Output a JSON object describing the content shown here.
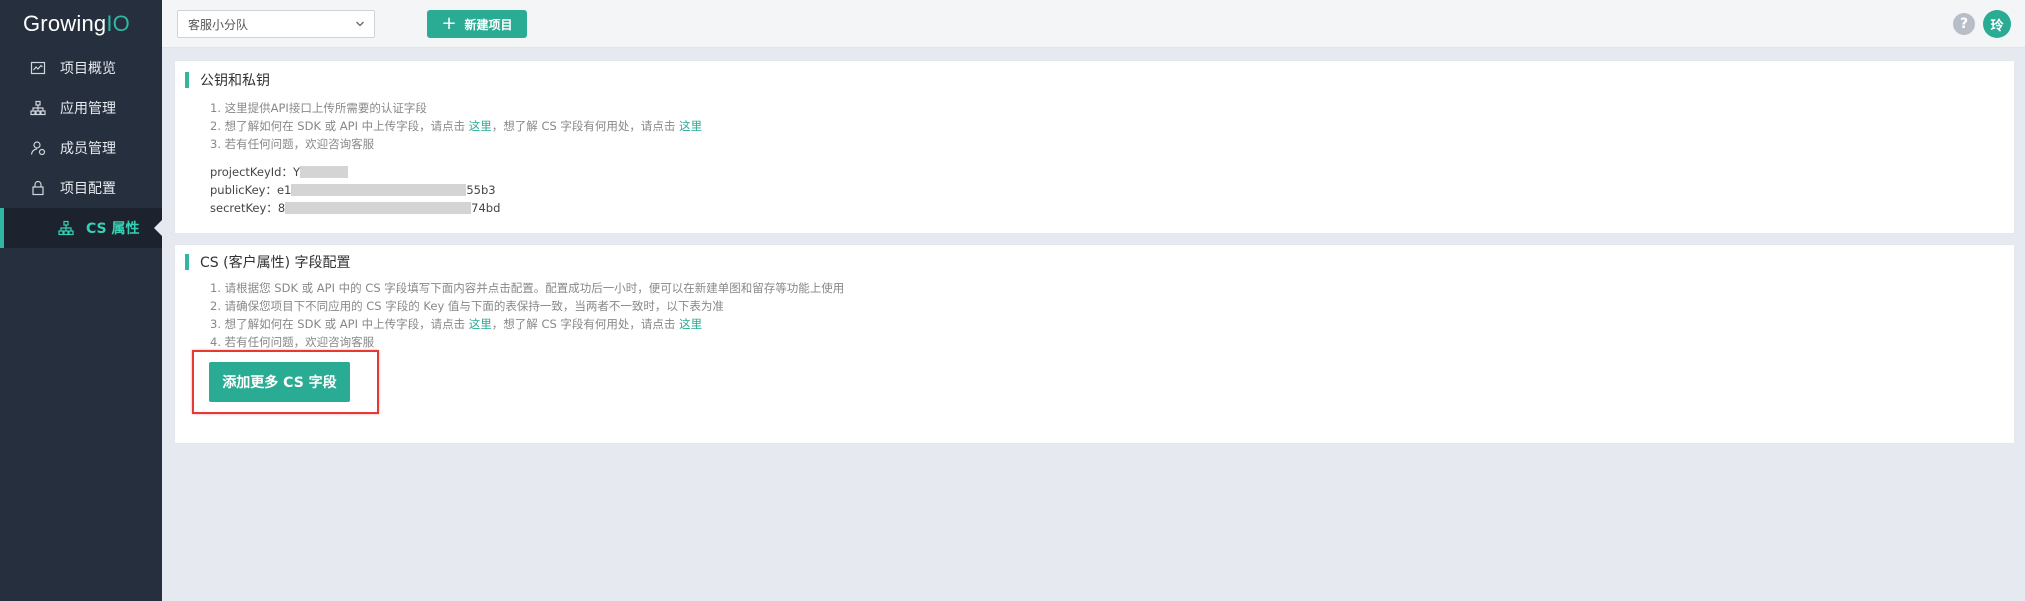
{
  "logo": {
    "text_main": "Growing",
    "text_accent": "IO"
  },
  "sidebar": {
    "items": [
      {
        "label": "项目概览",
        "icon": "chart-icon"
      },
      {
        "label": "应用管理",
        "icon": "hierarchy-icon"
      },
      {
        "label": "成员管理",
        "icon": "user-settings-icon"
      },
      {
        "label": "项目配置",
        "icon": "lock-icon"
      }
    ],
    "sub_item": {
      "label": "CS 属性",
      "icon": "hierarchy-icon"
    }
  },
  "topbar": {
    "team_select": {
      "value": "客服小分队"
    },
    "new_project_label": "新建项目",
    "help_label": "?",
    "avatar_text": "玲"
  },
  "keys_panel": {
    "title": "公钥和私钥",
    "notes": [
      {
        "text": "1. 这里提供API接口上传所需要的认证字段"
      },
      {
        "pre": "2. 想了解如何在 SDK 或 API 中上传字段，请点击 ",
        "link1": "这里",
        "mid": "，想了解 CS 字段有何用处，请点击 ",
        "link2": "这里"
      },
      {
        "text": "3. 若有任何问题，欢迎咨询客服"
      }
    ],
    "project_key_id": {
      "label": "projectKeyId：",
      "value": "Y"
    },
    "public_key": {
      "label": "publicKey：",
      "prefix": "e1",
      "suffix": "55b3"
    },
    "secret_key": {
      "label": "secretKey：",
      "prefix": "8",
      "suffix": "74bd"
    }
  },
  "cs_panel": {
    "title": "CS (客户属性) 字段配置",
    "notes": [
      {
        "text": "1. 请根据您 SDK 或 API 中的 CS 字段填写下面内容并点击配置。配置成功后一小时，便可以在新建单图和留存等功能上使用"
      },
      {
        "text": "2. 请确保您项目下不同应用的 CS 字段的 Key 值与下面的表保持一致，当两者不一致时，以下表为准"
      },
      {
        "pre": "3. 想了解如何在 SDK 或 API 中上传字段，请点击 ",
        "link1": "这里",
        "mid": "，想了解 CS 字段有何用处，请点击 ",
        "link2": "这里"
      },
      {
        "text": "4. 若有任何问题，欢迎咨询客服"
      }
    ],
    "add_button_label": "添加更多 CS 字段"
  },
  "colors": {
    "accent": "#2aab93",
    "sidebar_bg": "#262f3d",
    "highlight": "#e53935"
  }
}
